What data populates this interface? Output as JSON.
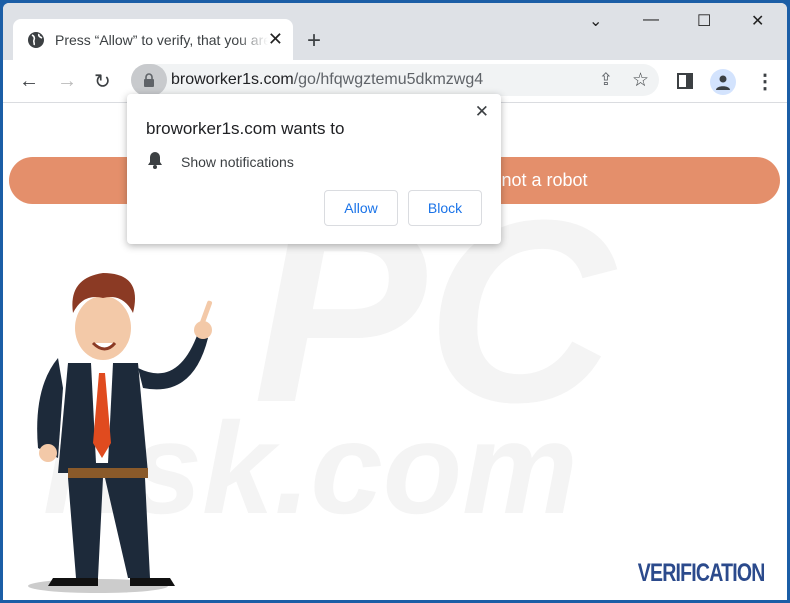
{
  "tab": {
    "title": "Press “Allow” to verify, that you are not a robot",
    "icon": "globe-icon"
  },
  "address": {
    "domain": "broworker1s.com",
    "path": "/go/hfqwgztemu5dkmzwg4"
  },
  "popup": {
    "title": "broworker1s.com wants to",
    "permission": "Show notifications",
    "allow": "Allow",
    "block": "Block"
  },
  "page": {
    "banner": "not a robot",
    "logo": "VERIFICATION",
    "watermark": "risk.com"
  },
  "colors": {
    "frame": "#1b5ea6",
    "banner": "#e48f6b",
    "link": "#1a73e8"
  }
}
